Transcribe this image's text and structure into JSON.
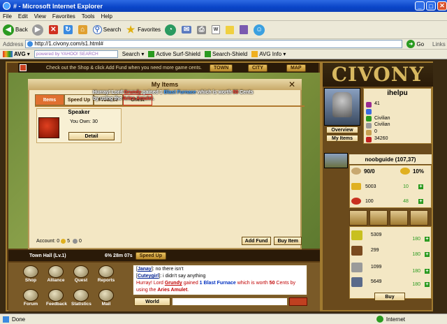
{
  "window": {
    "title": "# - Microsoft Internet Explorer"
  },
  "menu": [
    "File",
    "Edit",
    "View",
    "Favorites",
    "Tools",
    "Help"
  ],
  "toolbar": {
    "back": "Back",
    "search": "Search",
    "favorites": "Favorites"
  },
  "address": {
    "label": "Address",
    "url": "http://1.civony.com/s1.html#",
    "go": "Go",
    "links": "Links"
  },
  "avgbar": {
    "brand": "AVG",
    "search_placeholder": "powered by YAHOO! SEARCH",
    "search_btn": "Search",
    "active": "Active",
    "surf_shield": "Surf-Shield",
    "search_shield": "Search-Shield",
    "avg_info": "AVG Info"
  },
  "game": {
    "topstrip_text": "Check out the Shop & click Add Fund when you need more game cents.",
    "buttons": {
      "town": "TOWN",
      "city": "CITY",
      "map": "MAP"
    },
    "panel": {
      "title": "My Items",
      "tabs": [
        "Items",
        "Speed Up",
        "Produce",
        "Chest"
      ],
      "item": {
        "name": "Speaker",
        "own_label": "You Own:",
        "own_count": "30",
        "detail": "Detail"
      },
      "account_label": "Account:",
      "account_a": "0",
      "account_b": "5",
      "account_c": "0",
      "add_fund": "Add Fund",
      "buy_item": "Buy Item"
    },
    "announce": {
      "p1": "Hurray! Lord ",
      "lord": "Grundy",
      "p2": " gained 1 ",
      "item": "Blast Furnace",
      "p3": " which is worth ",
      "cents": "50",
      "p4": " Cents by using the ",
      "amulet": "Aries Amulet",
      "p5": "."
    },
    "status": {
      "building": "Town Hall (Lv.1)",
      "timer": "6% 28m 07s",
      "speed_up": "Speed Up"
    },
    "bottom_icons": [
      "Shop",
      "Alliance",
      "Quest",
      "Reports",
      "Forum",
      "Feedback",
      "Statistics",
      "Mail"
    ],
    "chat": [
      {
        "name": "Janay",
        "text": ": no there isn't"
      },
      {
        "name": "Cuteygirl",
        "text": ": i didn't say anything"
      }
    ],
    "chat_announce": {
      "p1": "Hurray! Lord ",
      "lord": "Grundy",
      "p2": " gained ",
      "item": "1 Blast Furnace",
      "p3": " which is worth ",
      "cents": "50",
      "p4": " Cents by using the ",
      "amulet": "Aries Amulet",
      "p5": "."
    },
    "world_tab": "World"
  },
  "sidebar": {
    "logo": "CIVONY",
    "player": {
      "name": "ihelpu",
      "level": "41",
      "flag1": "Civilian",
      "flag2": "Civilian",
      "val1": "0",
      "val2": "34260"
    },
    "overview": "Overview",
    "my_items": "My Items",
    "city": {
      "name": "noobguide",
      "coords": "(107,37)",
      "pop": "90/0",
      "loyalty": "10%"
    },
    "resources": [
      {
        "amount": "5003",
        "rate": "10"
      },
      {
        "amount": "100",
        "rate": "48"
      }
    ],
    "units": [
      {
        "amount": "5309",
        "rate": "180"
      },
      {
        "amount": "299",
        "rate": "180"
      },
      {
        "amount": "1099",
        "rate": "180"
      },
      {
        "amount": "5649",
        "rate": "180"
      }
    ],
    "buy": "Buy"
  },
  "statusbar": {
    "left": "Done",
    "right": "Internet"
  }
}
